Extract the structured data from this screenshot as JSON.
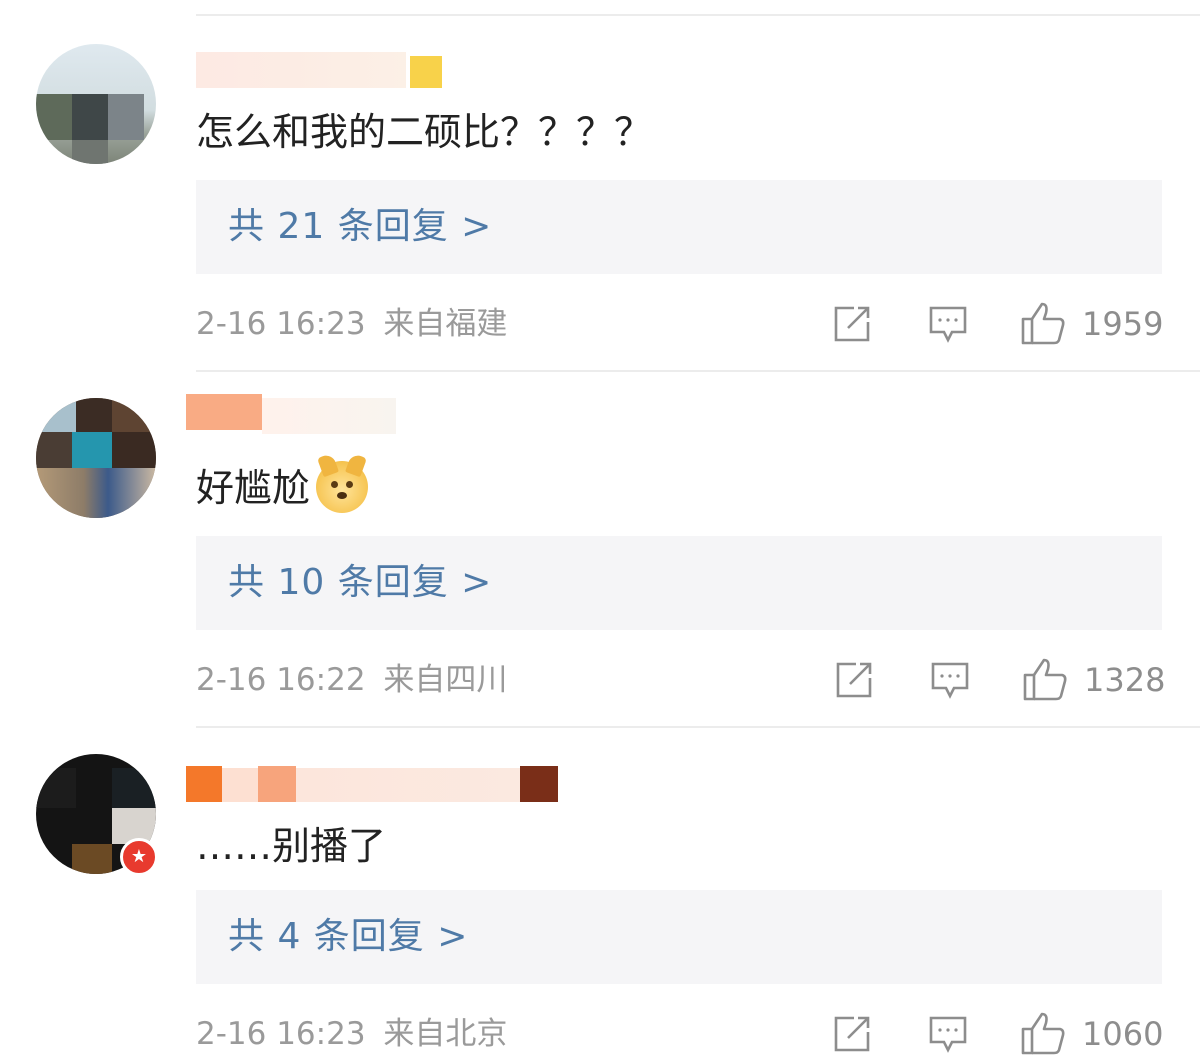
{
  "comments": [
    {
      "content": "怎么和我的二硕比？？？？",
      "reply_summary": "共 21 条回复 >",
      "time": "2-16 16:23",
      "location": "来自福建",
      "likes": "1959"
    },
    {
      "content": "好尴尬",
      "emoji": "doge-emoji",
      "reply_summary": "共 10 条回复 >",
      "time": "2-16 16:22",
      "location": "来自四川",
      "likes": "1328"
    },
    {
      "content": "……别播了",
      "badge": "★",
      "reply_summary": "共 4 条回复 >",
      "time": "2-16 16:23",
      "location": "来自北京",
      "likes": "1060"
    }
  ],
  "icons": [
    "share-icon",
    "comment-icon",
    "like-icon"
  ],
  "colors": {
    "reply_link": "#4f7aa7",
    "meta_text": "#9a9a9a",
    "reply_bg": "#f5f5f7",
    "badge": "#e83a2e"
  }
}
